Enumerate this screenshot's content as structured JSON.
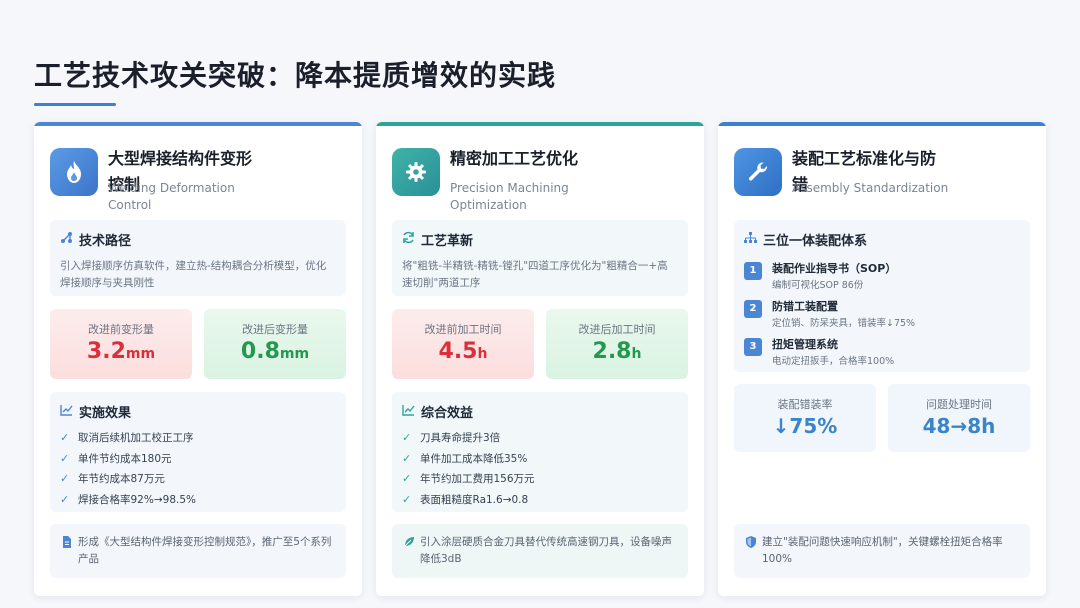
{
  "page": {
    "title": "工艺技术攻关突破：降本提质增效的实践"
  },
  "cards": [
    {
      "title": "大型焊接结构件变形控制",
      "subtitle": "Welding Deformation Control",
      "icon": "flame-icon",
      "section": {
        "icon": "route-icon",
        "title": "技术路径",
        "text": "引入焊接顺序仿真软件，建立热-结构耦合分析模型，优化焊接顺序与夹具刚性"
      },
      "metrics": [
        {
          "label": "改进前变形量",
          "value": "3.2",
          "unit": "mm"
        },
        {
          "label": "改进后变形量",
          "value": "0.8",
          "unit": "mm"
        }
      ],
      "effects": {
        "icon": "chart-line-icon",
        "title": "实施效果",
        "items": [
          "取消后续机加工校正工序",
          "单件节约成本180元",
          "年节约成本87万元",
          "焊接合格率92%→98.5%"
        ]
      },
      "footer": {
        "icon": "document-icon",
        "text": "形成《大型结构件焊接变形控制规范》，推广至5个系列产品"
      }
    },
    {
      "title": "精密加工工艺优化",
      "subtitle": "Precision Machining Optimization",
      "icon": "gear-icon",
      "section": {
        "icon": "refresh-icon",
        "title": "工艺革新",
        "text": "将\"粗铣-半精铣-精铣-镗孔\"四道工序优化为\"粗精合一+高速切削\"两道工序"
      },
      "metrics": [
        {
          "label": "改进前加工时间",
          "value": "4.5",
          "unit": "h"
        },
        {
          "label": "改进后加工时间",
          "value": "2.8",
          "unit": "h"
        }
      ],
      "effects": {
        "icon": "chart-line-icon",
        "title": "综合效益",
        "items": [
          "刀具寿命提升3倍",
          "单件加工成本降低35%",
          "年节约加工费用156万元",
          "表面粗糙度Ra1.6→0.8"
        ]
      },
      "footer": {
        "icon": "leaf-icon",
        "text": "引入涂层硬质合金刀具替代传统高速钢刀具，设备噪声降低3dB"
      }
    },
    {
      "title": "装配工艺标准化与防错",
      "subtitle": "Assembly Standardization",
      "icon": "wrench-icon",
      "section": {
        "icon": "hierarchy-icon",
        "title": "三位一体装配体系",
        "steps": [
          {
            "num": "1",
            "title": "装配作业指导书（SOP）",
            "desc": "编制可视化SOP 86份"
          },
          {
            "num": "2",
            "title": "防错工装配置",
            "desc": "定位销、防呆夹具，错装率↓75%"
          },
          {
            "num": "3",
            "title": "扭矩管理系统",
            "desc": "电动定扭扳手，合格率100%"
          }
        ]
      },
      "metrics": [
        {
          "label": "装配错装率",
          "value": "↓75%",
          "unit": ""
        },
        {
          "label": "问题处理时间",
          "value": "48→8h",
          "unit": ""
        }
      ],
      "footer": {
        "icon": "shield-icon",
        "text": "建立\"装配问题快速响应机制\"，关键螺栓扭矩合格率100%"
      }
    }
  ],
  "colors": {
    "accent": "#3b7fd6",
    "teal": "#2aa59a",
    "bad": "#d9303b",
    "good": "#23994f"
  }
}
